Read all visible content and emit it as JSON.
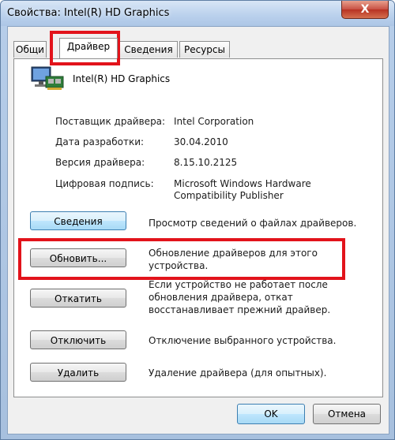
{
  "window": {
    "title": "Свойства: Intel(R) HD Graphics",
    "close_glyph": "X"
  },
  "tabs": [
    {
      "label": "Общи"
    },
    {
      "label": "Драйвер",
      "active": true
    },
    {
      "label": "Сведения"
    },
    {
      "label": "Ресурсы"
    }
  ],
  "device": {
    "name": "Intel(R) HD Graphics",
    "icon": "display-adapter-icon"
  },
  "properties": [
    {
      "label": "Поставщик драйвера:",
      "value": "Intel Corporation"
    },
    {
      "label": "Дата разработки:",
      "value": "30.04.2010"
    },
    {
      "label": "Версия драйвера:",
      "value": "8.15.10.2125"
    },
    {
      "label": "Цифровая подпись:",
      "value": "Microsoft Windows Hardware Compatibility Publisher"
    }
  ],
  "actions": [
    {
      "button": "Сведения",
      "description": "Просмотр сведений о файлах драйверов."
    },
    {
      "button": "Обновить...",
      "description": "Обновление драйверов для этого устройства."
    },
    {
      "button": "Откатить",
      "description": "Если устройство не работает после обновления драйвера, откат восстанавливает прежний драйвер."
    },
    {
      "button": "Отключить",
      "description": "Отключение выбранного устройства."
    },
    {
      "button": "Удалить",
      "description": "Удаление драйвера (для опытных)."
    }
  ],
  "footer": {
    "ok_label": "OK",
    "cancel_label": "Отмена"
  },
  "highlight_color": "#e2131b"
}
